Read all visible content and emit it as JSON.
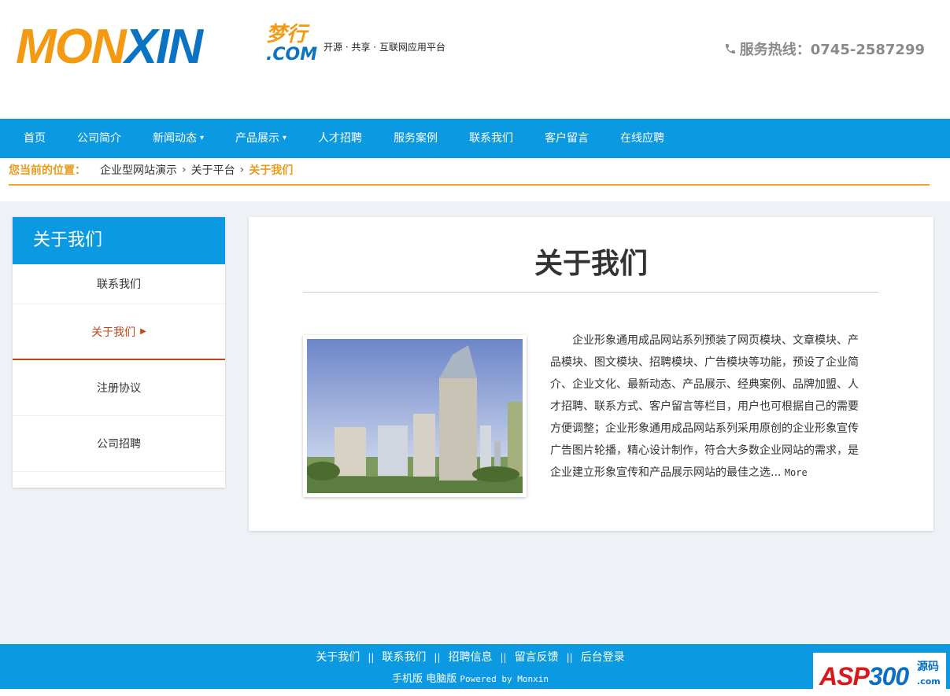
{
  "header": {
    "logo_part1": "MON",
    "logo_part2": "XIN",
    "logo_cn": "梦行",
    "logo_com": ".COM",
    "slogan": "开源 · 共享 · 互联网应用平台",
    "hotline": "服务热线：0745-2587299"
  },
  "nav": {
    "items": [
      {
        "label": "首页",
        "dropdown": false
      },
      {
        "label": "公司简介",
        "dropdown": false
      },
      {
        "label": "新闻动态",
        "dropdown": true
      },
      {
        "label": "产品展示",
        "dropdown": true
      },
      {
        "label": "人才招聘",
        "dropdown": false
      },
      {
        "label": "服务案例",
        "dropdown": false
      },
      {
        "label": "联系我们",
        "dropdown": false
      },
      {
        "label": "客户留言",
        "dropdown": false
      },
      {
        "label": "在线应聘",
        "dropdown": false
      }
    ],
    "chevron": "⌄"
  },
  "breadcrumb": {
    "label": "您当前的位置：",
    "path": [
      "企业型网站演示",
      "关于平台"
    ],
    "current": "关于我们",
    "separator": "›"
  },
  "sidebar": {
    "title": "关于我们",
    "items": [
      {
        "label": "联系我们",
        "active": false
      },
      {
        "label": "关于我们",
        "active": true
      },
      {
        "label": "注册协议",
        "active": false
      },
      {
        "label": "公司招聘",
        "active": false
      }
    ]
  },
  "main": {
    "title": "关于我们",
    "description": "企业形象通用成品网站系列预装了网页模块、文章模块、产品模块、图文模块、招聘模块、广告模块等功能，预设了企业简介、企业文化、最新动态、产品展示、经典案例、品牌加盟、人才招聘、联系方式、客户留言等栏目，用户也可根据自己的需要方便调整；企业形象通用成品网站系列采用原创的企业形象宣传广告图片轮播，精心设计制作，符合大多数企业网站的需求，是企业建立形象宣传和产品展示网站的最佳之选...",
    "more": "More"
  },
  "footer": {
    "links": [
      "关于我们",
      "联系我们",
      "招聘信息",
      "留言反馈",
      "后台登录"
    ],
    "separator": "||",
    "mobile": "手机版",
    "desktop": "电脑版",
    "powered": "Powered by Monxin",
    "badge_asp": "ASP",
    "badge_300": "300",
    "badge_cn": "源码",
    "badge_com": ".com"
  },
  "colors": {
    "primary_blue": "#0b9ae2",
    "accent_orange": "#f39a12",
    "active_red": "#c0451b"
  }
}
